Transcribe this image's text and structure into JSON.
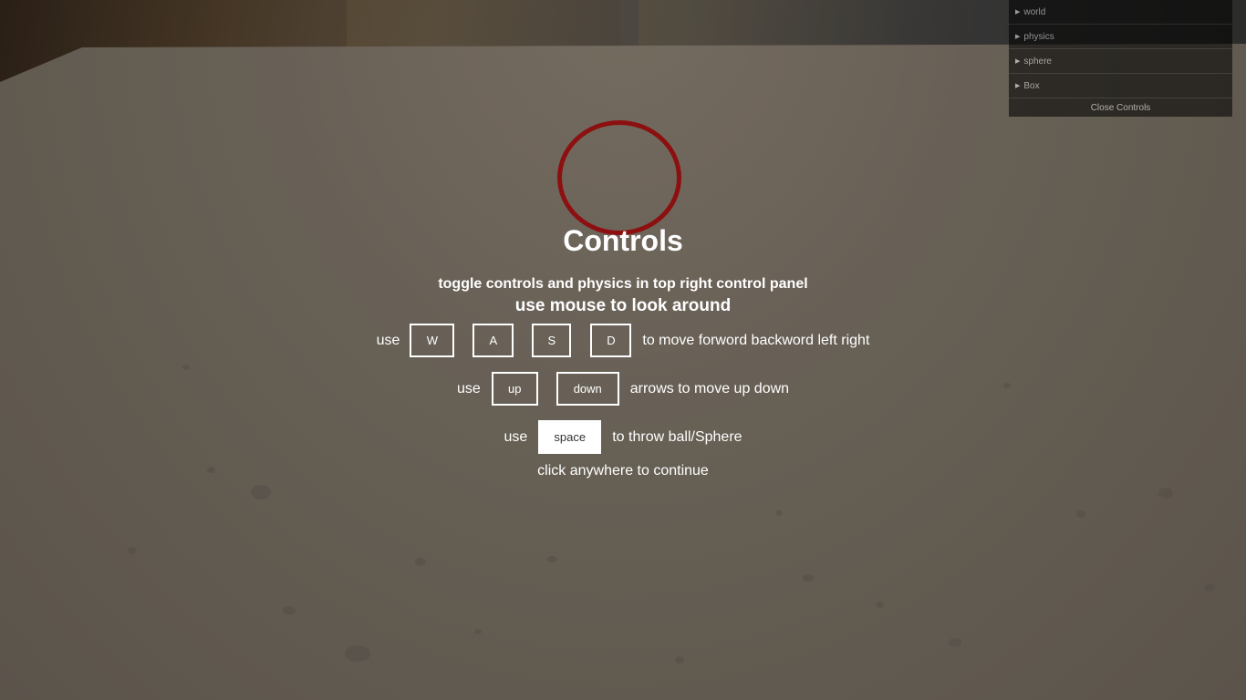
{
  "overlay": {
    "title": "Controls",
    "subtitle_top": "toggle controls and physics in top right control panel",
    "subtitle_mouse": "use mouse to look around",
    "move_row": {
      "prefix": "use",
      "keys": [
        "W",
        "A",
        "S",
        "D"
      ],
      "suffix": "to move forword backword left right"
    },
    "arrow_row": {
      "prefix": "use",
      "keys": [
        "up",
        "down"
      ],
      "suffix": "arrows to move up down"
    },
    "throw_row": {
      "prefix": "use",
      "key": "space",
      "suffix": "to throw ball/Sphere"
    },
    "continue": "click anywhere to continue"
  },
  "gui": {
    "folders": [
      "world",
      "physics",
      "sphere",
      "Box"
    ],
    "close_label": "Close Controls"
  },
  "colors": {
    "crosshair": "#8c1010",
    "text": "#ffffff",
    "panel": "#000000"
  }
}
